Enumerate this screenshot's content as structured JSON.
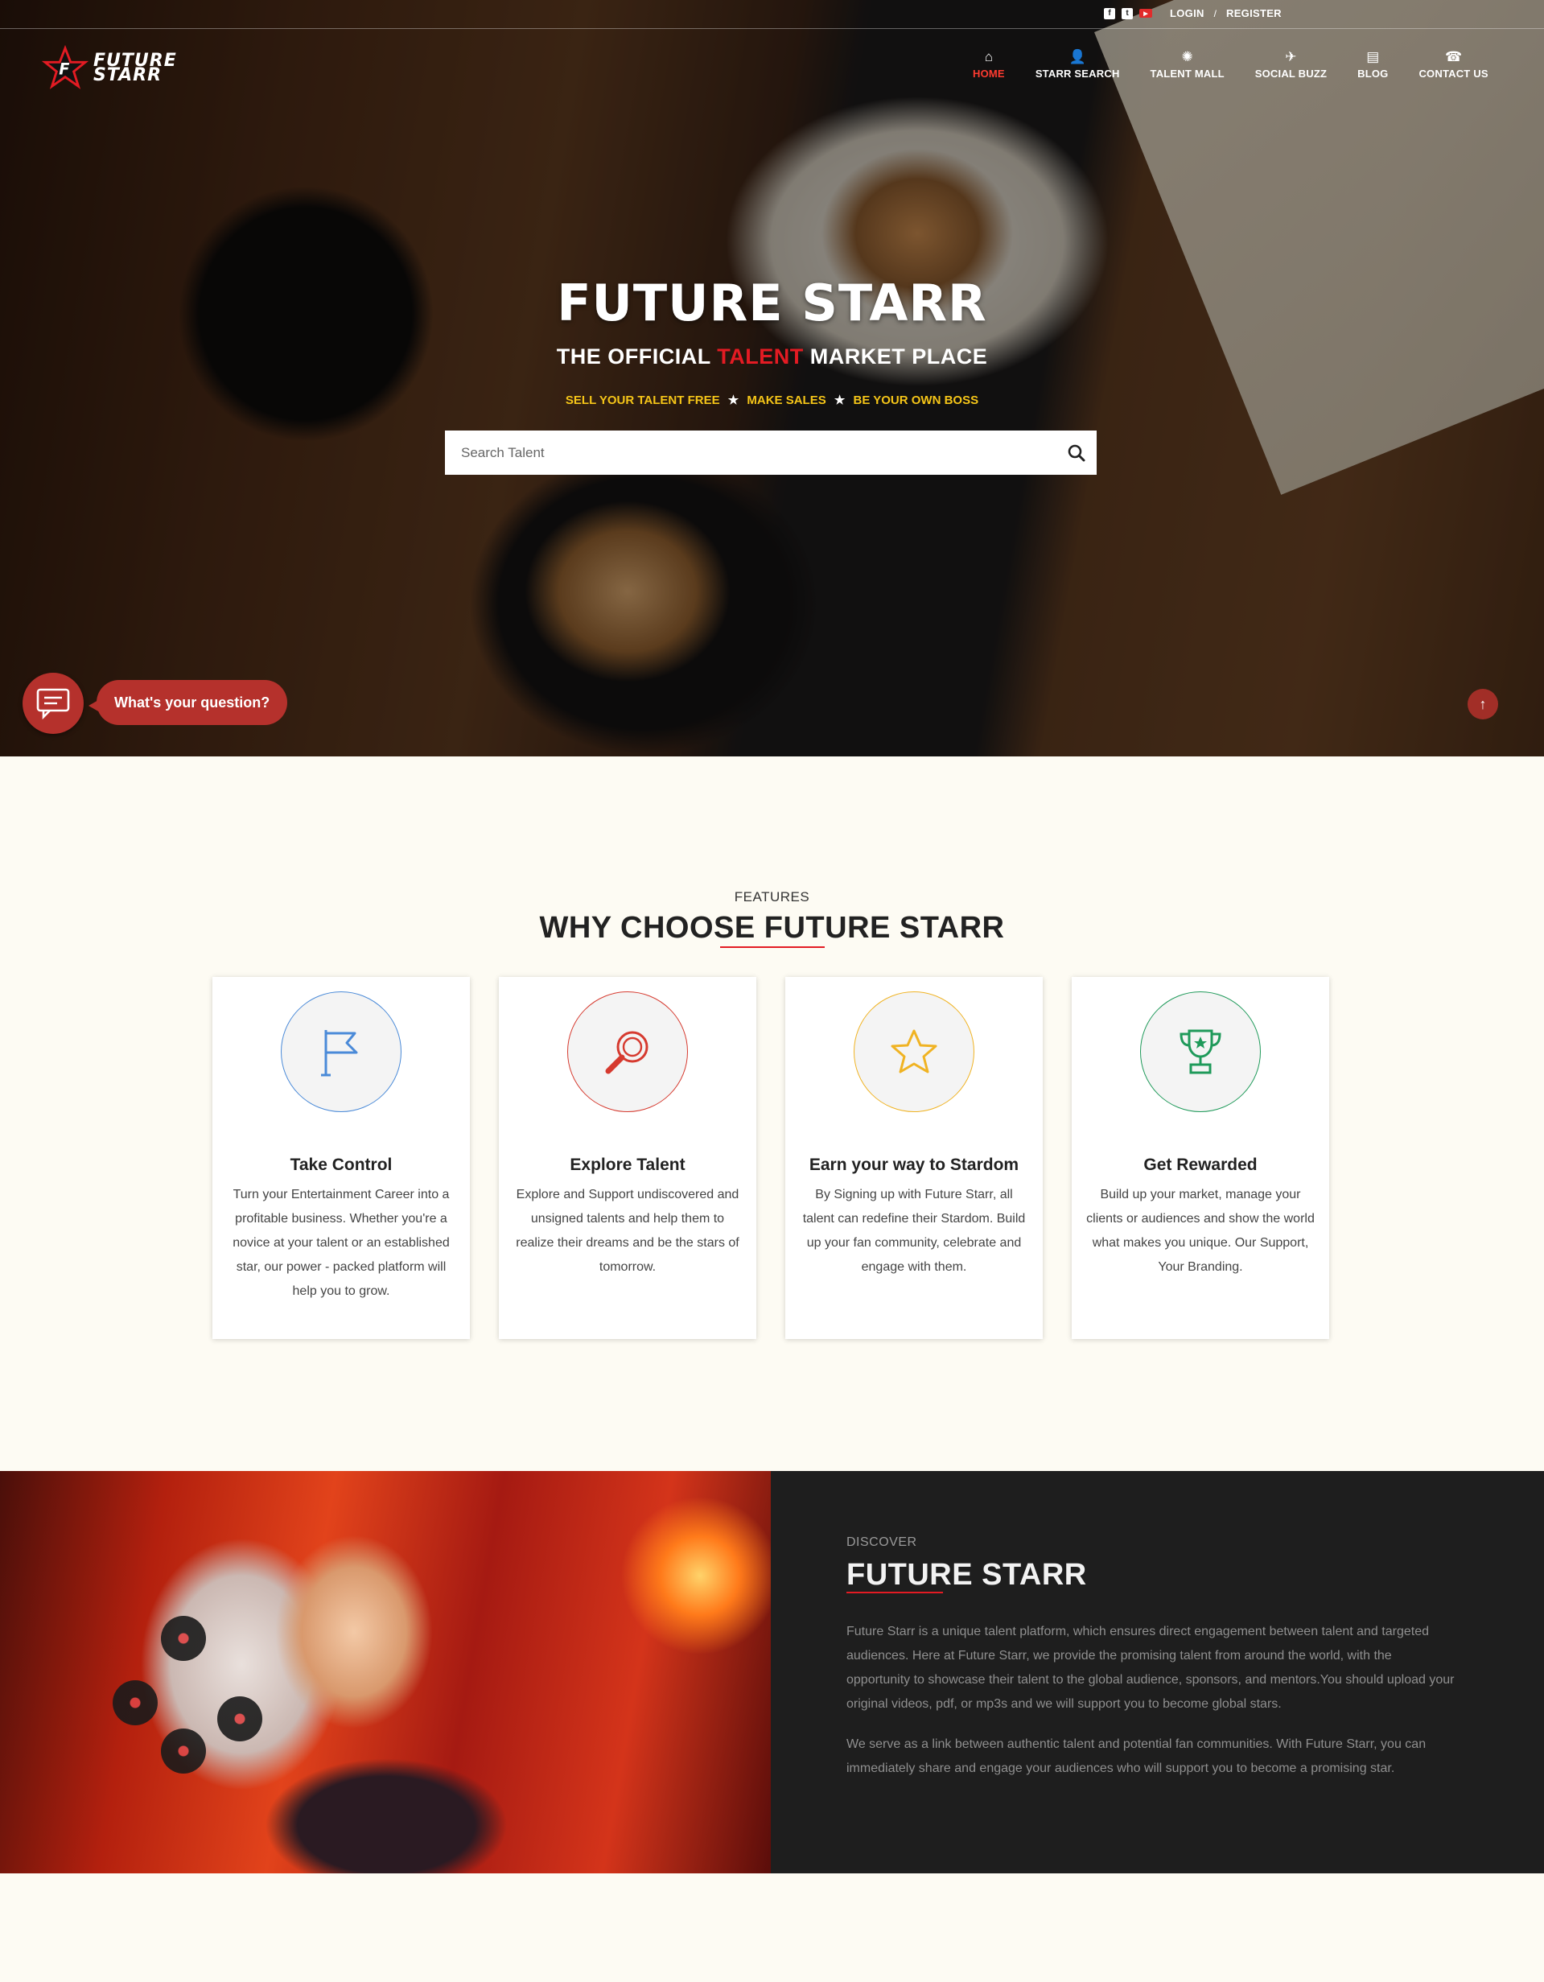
{
  "topbar": {
    "social": [
      {
        "icon": "facebook-icon",
        "glyph": "f"
      },
      {
        "icon": "twitter-icon",
        "glyph": "t"
      },
      {
        "icon": "youtube-icon",
        "glyph": "▶"
      }
    ],
    "login": "LOGIN",
    "separator": "/",
    "register": "REGISTER"
  },
  "logo": {
    "line1": "FUTURE",
    "line2": "STARR"
  },
  "nav": [
    {
      "label": "HOME",
      "icon": "home-icon",
      "glyph": "⌂",
      "active": true
    },
    {
      "label": "STARR SEARCH",
      "icon": "user-search-icon",
      "glyph": "👤",
      "active": false
    },
    {
      "label": "TALENT MALL",
      "icon": "mall-icon",
      "glyph": "✺",
      "active": false
    },
    {
      "label": "SOCIAL BUZZ",
      "icon": "social-icon",
      "glyph": "✈",
      "active": false
    },
    {
      "label": "BLOG",
      "icon": "blog-icon",
      "glyph": "▤",
      "active": false
    },
    {
      "label": "CONTACT US",
      "icon": "phone-icon",
      "glyph": "☎",
      "active": false
    }
  ],
  "hero": {
    "title": "FUTURE STARR",
    "subtitle_pre": "THE OFFICIAL ",
    "subtitle_hl": "TALENT",
    "subtitle_post": " MARKET PLACE",
    "tag1": "SELL YOUR TALENT FREE",
    "tag2": "MAKE SALES",
    "tag3": "BE YOUR OWN BOSS",
    "tag_sep": "★",
    "search_placeholder": "Search Talent",
    "search_value": ""
  },
  "chat": {
    "label": "What's your question?"
  },
  "scroll_top": {
    "glyph": "↑"
  },
  "features": {
    "kicker": "FEATURES",
    "title": "WHY CHOOSE FUTURE STARR",
    "cards": [
      {
        "title": "Take Control",
        "icon": "flag-icon",
        "color": "#4a8ad8",
        "desc": "Turn your Entertainment Career into a profitable business. Whether you're a novice at your talent or an established star, our power - packed platform will help you to grow."
      },
      {
        "title": "Explore Talent",
        "icon": "magnifier-icon",
        "color": "#d63a2f",
        "desc": "Explore and Support undiscovered and unsigned talents and help them to realize their dreams and be the stars of tomorrow."
      },
      {
        "title": "Earn your way to Stardom",
        "icon": "star-icon",
        "color": "#f0b323",
        "desc": "By Signing up with Future Starr, all talent can redefine their Stardom. Build up your fan community, celebrate and engage with them."
      },
      {
        "title": "Get Rewarded",
        "icon": "trophy-icon",
        "color": "#1f9a5a",
        "desc": "Build up your market, manage your clients or audiences and show the world what makes you unique. Our Support, Your Branding."
      }
    ]
  },
  "discover": {
    "kicker": "DISCOVER",
    "title": "FUTURE STARR",
    "p1": "Future Starr is a unique talent platform, which ensures direct engagement between talent and targeted audiences. Here at Future Starr, we provide the promising talent from around the world, with the opportunity to showcase their talent to the global audience, sponsors, and mentors.You should upload your original videos, pdf, or mp3s and we will support you to become global stars.",
    "p2": "We serve as a link between authentic talent and potential fan communities. With Future Starr, you can immediately share and engage your audiences who will support you to become a promising star."
  }
}
